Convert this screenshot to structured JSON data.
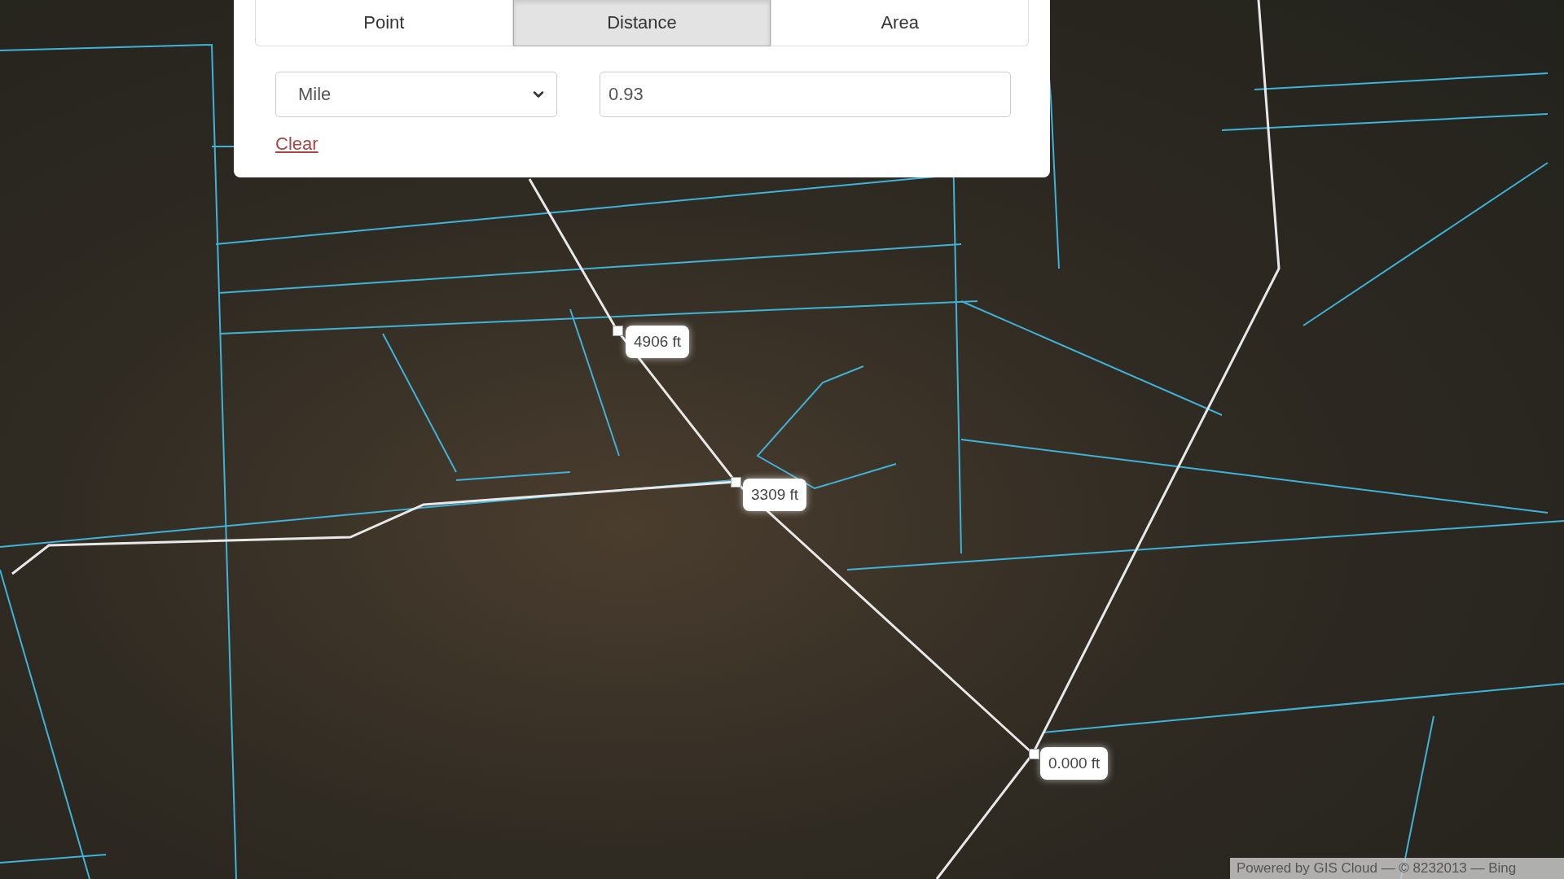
{
  "measure_panel": {
    "tabs": [
      {
        "label": "Point",
        "selected": false
      },
      {
        "label": "Distance",
        "selected": true
      },
      {
        "label": "Area",
        "selected": false
      }
    ],
    "unit_select": {
      "value": "Mile"
    },
    "result_field": {
      "value": "0.93"
    },
    "clear_link": "Clear"
  },
  "map": {
    "measurement_labels": [
      "4906 ft",
      "3309 ft",
      "0.000 ft"
    ],
    "attribution": "Powered by GIS Cloud — © 8232013 — Bing"
  }
}
